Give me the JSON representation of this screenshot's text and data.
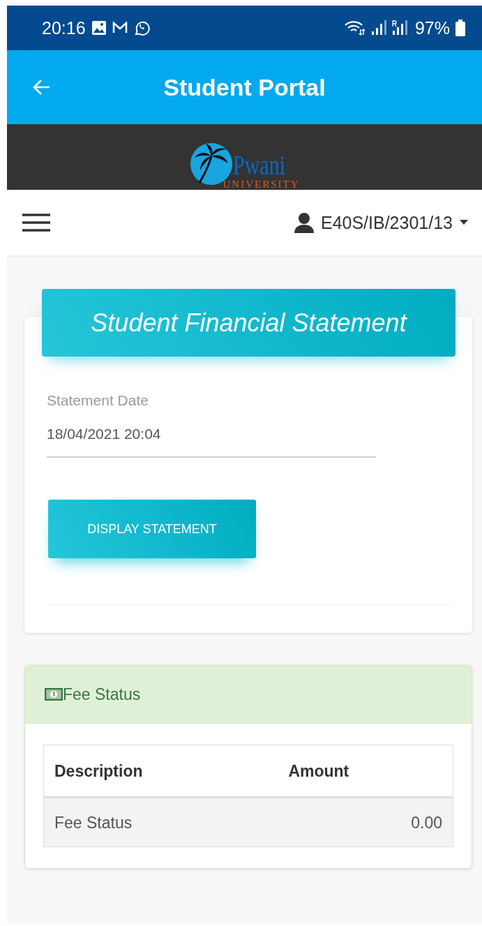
{
  "status_bar": {
    "time": "20:16",
    "battery": "97%"
  },
  "app_bar": {
    "title": "Student Portal"
  },
  "logo": {
    "name": "Pwani",
    "subtitle": "UNIVERSITY"
  },
  "nav": {
    "user": "E40S/IB/2301/13"
  },
  "statement_card": {
    "title": "Student Financial Statement",
    "field": {
      "label": "Statement Date",
      "value": "18/04/2021 20:04"
    },
    "button": "DISPLAY STATEMENT"
  },
  "fee_panel": {
    "title": "Fee Status",
    "table": {
      "columns": [
        "Description",
        "Amount"
      ],
      "rows": [
        [
          "Fee Status",
          "0.00"
        ]
      ]
    }
  }
}
